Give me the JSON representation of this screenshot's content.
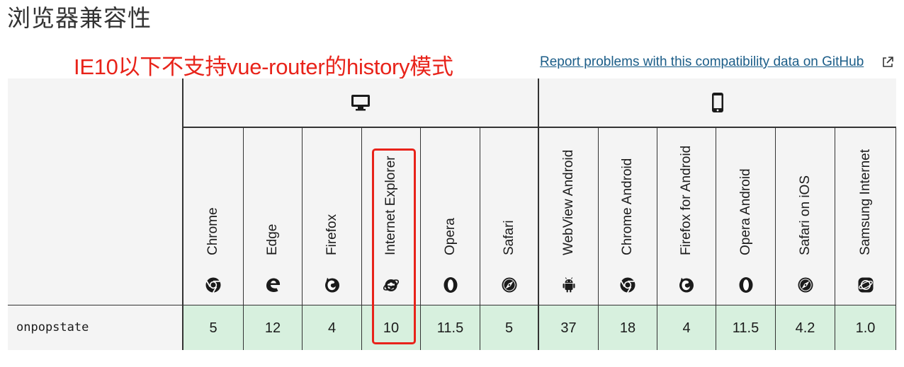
{
  "page_title": "浏览器兼容性",
  "annotation": "IE10以下不支持vue-router的history模式",
  "report_link": "Report problems with this compatibility data on GitHub",
  "row_label": "onpopstate",
  "browsers": [
    {
      "name": "Chrome",
      "icon": "chrome-icon",
      "value": "5"
    },
    {
      "name": "Edge",
      "icon": "edge-icon",
      "value": "12"
    },
    {
      "name": "Firefox",
      "icon": "firefox-icon",
      "value": "4"
    },
    {
      "name": "Internet Explorer",
      "icon": "internet-explorer-icon",
      "value": "10"
    },
    {
      "name": "Opera",
      "icon": "opera-icon",
      "value": "11.5"
    },
    {
      "name": "Safari",
      "icon": "safari-icon",
      "value": "5"
    },
    {
      "name": "WebView Android",
      "icon": "android-icon",
      "value": "37"
    },
    {
      "name": "Chrome Android",
      "icon": "chrome-icon",
      "value": "18"
    },
    {
      "name": "Firefox for Android",
      "icon": "firefox-icon",
      "value": "4"
    },
    {
      "name": "Opera Android",
      "icon": "opera-icon",
      "value": "11.5"
    },
    {
      "name": "Safari on iOS",
      "icon": "safari-icon",
      "value": "4.2"
    },
    {
      "name": "Samsung Internet",
      "icon": "samsung-internet-icon",
      "value": "1.0"
    }
  ],
  "colors": {
    "support_cell": "#d7f0de",
    "header_bg": "#f4f4f4",
    "annotation": "#e8231a",
    "link": "#1b5d88"
  }
}
